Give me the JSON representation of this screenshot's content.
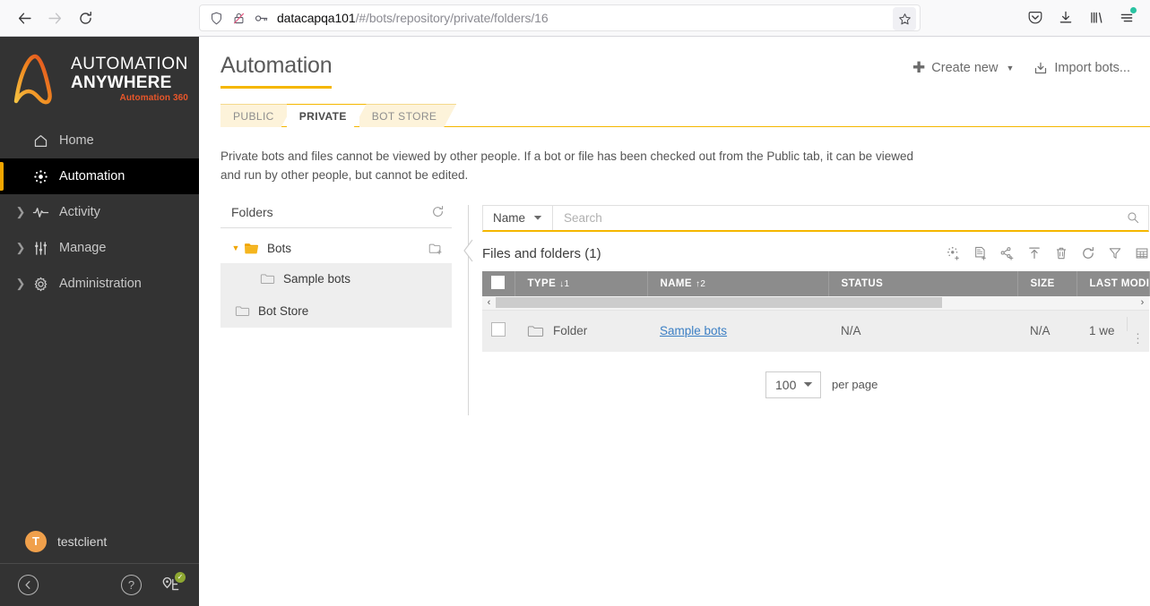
{
  "browser": {
    "back_label": "Back",
    "forward_label": "Forward",
    "reload_label": "Reload",
    "url_host": "datacapqa101",
    "url_path": "/#/bots/repository/private/folders/16",
    "shield_icon": "shield-icon",
    "lock_broken_icon": "lock-broken-icon",
    "key_icon": "key-icon",
    "bookmark_icon": "star-icon",
    "pocket_icon": "pocket-icon",
    "downloads_icon": "download-icon",
    "library_icon": "library-icon",
    "menu_icon": "hamburger-menu-icon"
  },
  "sidebar": {
    "logo": {
      "line1": "AUTOMATION",
      "line2": "ANYWHERE",
      "line3": "Automation 360"
    },
    "items": [
      {
        "label": "Home",
        "icon": "home-icon",
        "expandable": false,
        "active": false
      },
      {
        "label": "Automation",
        "icon": "automation-icon",
        "expandable": false,
        "active": true
      },
      {
        "label": "Activity",
        "icon": "activity-pulse-icon",
        "expandable": true,
        "active": false
      },
      {
        "label": "Manage",
        "icon": "sliders-icon",
        "expandable": true,
        "active": false
      },
      {
        "label": "Administration",
        "icon": "gear-icon",
        "expandable": true,
        "active": false
      }
    ],
    "user": {
      "initial": "T",
      "name": "testclient"
    },
    "footer": {
      "collapse_icon": "collapse-left-icon",
      "help_icon": "question-mark-icon",
      "device_icon": "device-connected-icon"
    },
    "accent_color": "#f0a500",
    "background_color": "#333333"
  },
  "header": {
    "title": "Automation",
    "create_new_label": "Create new",
    "import_bots_label": "Import bots...",
    "underline_color": "#f5b700"
  },
  "tabs": [
    {
      "label": "PUBLIC",
      "active": false
    },
    {
      "label": "PRIVATE",
      "active": true
    },
    {
      "label": "BOT STORE",
      "active": false
    }
  ],
  "description": "Private bots and files cannot be viewed by other people. If a bot or file has been checked out from the Public tab, it can be viewed and run by other people, but cannot be edited.",
  "folders_pane": {
    "title": "Folders",
    "refresh_icon": "refresh-icon",
    "new_folder_icon": "new-folder-icon",
    "tree": [
      {
        "label": "Bots",
        "level": 0,
        "expanded": true,
        "selected": false
      },
      {
        "label": "Sample bots",
        "level": 1,
        "expanded": false,
        "selected": true
      },
      {
        "label": "Bot Store",
        "level": 0,
        "expanded": false,
        "selected": true
      }
    ]
  },
  "search": {
    "field_label": "Name",
    "placeholder": "Search",
    "value": "",
    "search_icon": "magnifier-icon"
  },
  "files_panel": {
    "title": "Files and folders",
    "count": "(1)",
    "toolbar_icons": [
      "create-bot-icon",
      "new-file-icon",
      "share-icon",
      "upload-icon",
      "delete-icon",
      "refresh-icon",
      "filter-icon",
      "columns-icon"
    ]
  },
  "table": {
    "columns": [
      {
        "label": "TYPE",
        "sort": "↓1"
      },
      {
        "label": "NAME",
        "sort": "↑2"
      },
      {
        "label": "STATUS",
        "sort": ""
      },
      {
        "label": "SIZE",
        "sort": ""
      },
      {
        "label": "LAST MODI",
        "sort": ""
      }
    ],
    "rows": [
      {
        "type": "Folder",
        "name": "Sample bots",
        "status": "N/A",
        "size": "N/A",
        "last_modified": "1 we",
        "type_icon": "folder-icon",
        "menu_icon": "kebab-menu-icon"
      }
    ],
    "scroll_left_arrow": "‹",
    "scroll_right_arrow": "›"
  },
  "pagination": {
    "per_page_value": "100",
    "per_page_label": "per page"
  }
}
